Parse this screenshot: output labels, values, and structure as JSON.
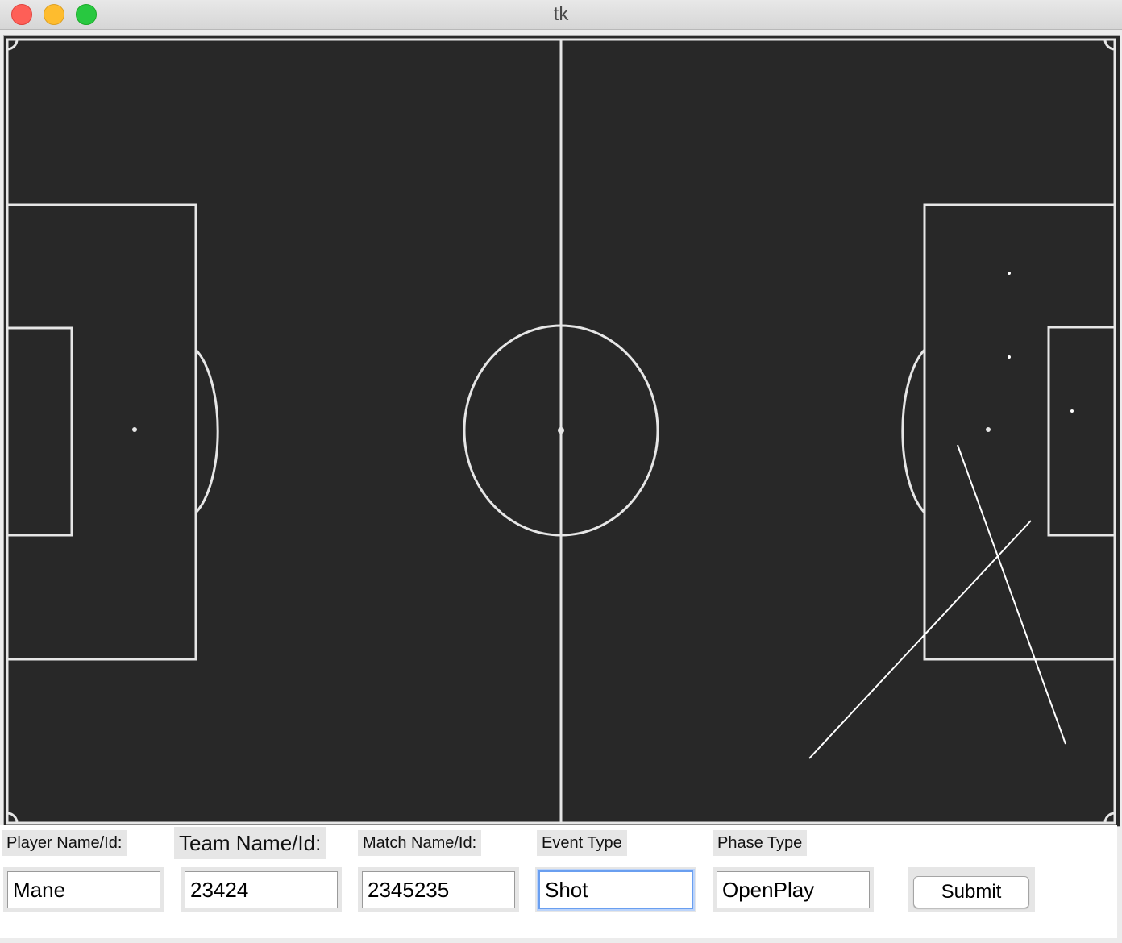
{
  "window": {
    "title": "tk"
  },
  "form": {
    "player": {
      "label": "Player Name/Id:",
      "value": "Mane"
    },
    "team": {
      "label": "Team Name/Id:",
      "value": "23424"
    },
    "match": {
      "label": "Match Name/Id:",
      "value": "2345235"
    },
    "event": {
      "label": "Event Type",
      "value": "Shot"
    },
    "phase": {
      "label": "Phase Type",
      "value": "OpenPlay"
    },
    "submit_label": "Submit"
  },
  "colors": {
    "pitch": "#282828",
    "lines": "#e6e6e6",
    "drawn": "#ffffff"
  }
}
